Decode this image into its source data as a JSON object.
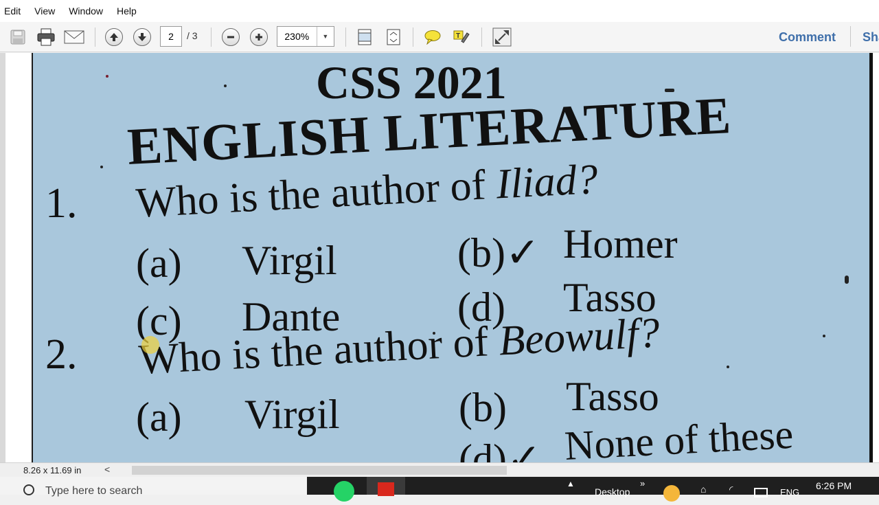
{
  "menu": [
    "Edit",
    "View",
    "Window",
    "Help"
  ],
  "toolbar": {
    "page_current": "2",
    "page_total": "/ 3",
    "zoom": "230%",
    "comment_label": "Comment",
    "share_label": "Sha"
  },
  "icons": {
    "save": "save-icon",
    "print": "print-icon",
    "email": "email-icon",
    "prev": "arrow-up-icon",
    "next": "arrow-down-icon",
    "zoom_out": "minus-icon",
    "zoom_in": "plus-icon",
    "fit_width": "fit-width-icon",
    "fit_page": "fit-page-icon",
    "sticky_note": "sticky-note-icon",
    "highlight": "highlight-text-icon",
    "fullscreen": "fullscreen-icon"
  },
  "document": {
    "title": "CSS 2021",
    "subject": "ENGLISH LITERATURE",
    "q1": {
      "number": "1.",
      "text": "Who is the author of ",
      "work": "Iliad?",
      "options": {
        "a_label": "(a)",
        "a": "Virgil",
        "b_label": "(b)✓",
        "b": "Homer",
        "c_label": "(c)",
        "c": "Dante",
        "d_label": "(d)",
        "d": "Tasso"
      }
    },
    "q2": {
      "number": "2.",
      "text": "Who is the author of ",
      "work": "Beowulf?",
      "options": {
        "a_label": "(a)",
        "a": "Virgil",
        "b_label": "(b)",
        "b": "Tasso",
        "d_label": "(d)✓",
        "d": "None of these"
      }
    }
  },
  "status": {
    "page_size": "8.26 x 11.69 in",
    "scroll_left": "<"
  },
  "taskbar": {
    "search_placeholder": "Type here to search",
    "desktop_label": "Desktop",
    "chevron": "»",
    "lang": "ENG",
    "time": "6:26 PM"
  },
  "colors": {
    "page_bg": "#a9c7dc",
    "link_blue": "#3f6faa",
    "taskbar": "#1f1f1f"
  }
}
